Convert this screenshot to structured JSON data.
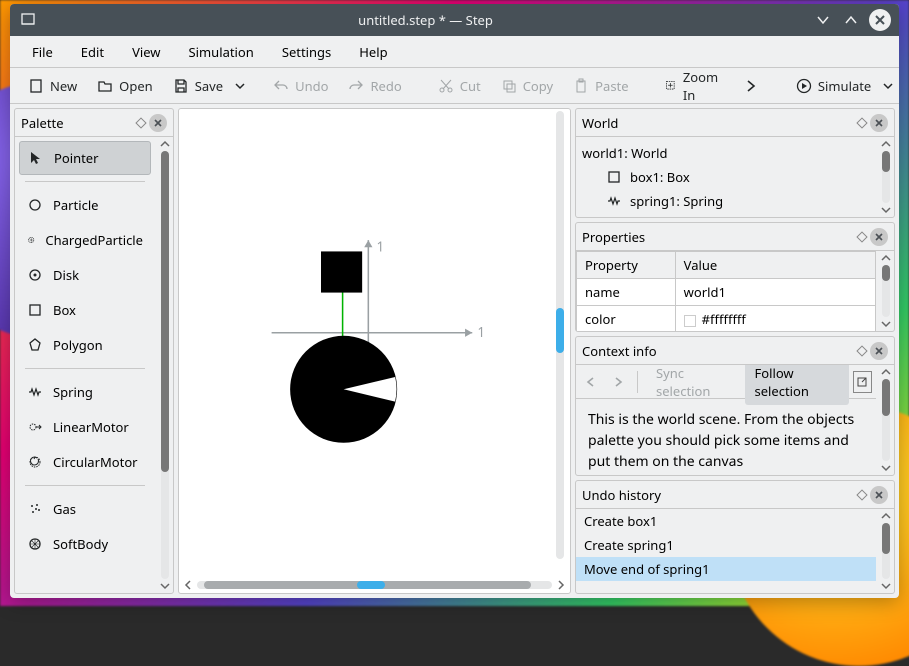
{
  "titlebar": {
    "title": "untitled.step * — Step"
  },
  "menu": [
    "File",
    "Edit",
    "View",
    "Simulation",
    "Settings",
    "Help"
  ],
  "toolbar": {
    "new": "New",
    "open": "Open",
    "save": "Save",
    "undo": "Undo",
    "redo": "Redo",
    "cut": "Cut",
    "copy": "Copy",
    "paste": "Paste",
    "zoom_in": "Zoom In",
    "simulate": "Simulate"
  },
  "palette": {
    "title": "Palette",
    "groups": [
      {
        "items": [
          {
            "name": "pointer",
            "label": "Pointer",
            "selected": true
          }
        ]
      },
      {
        "items": [
          {
            "name": "particle",
            "label": "Particle"
          },
          {
            "name": "charged-particle",
            "label": "ChargedParticle"
          },
          {
            "name": "disk",
            "label": "Disk"
          },
          {
            "name": "box",
            "label": "Box"
          },
          {
            "name": "polygon",
            "label": "Polygon"
          }
        ]
      },
      {
        "items": [
          {
            "name": "spring",
            "label": "Spring"
          },
          {
            "name": "linear-motor",
            "label": "LinearMotor"
          },
          {
            "name": "circular-motor",
            "label": "CircularMotor"
          }
        ]
      },
      {
        "items": [
          {
            "name": "gas",
            "label": "Gas"
          },
          {
            "name": "softbody",
            "label": "SoftBody"
          }
        ]
      }
    ]
  },
  "canvas": {
    "axis_x_label": "1",
    "axis_y_label": "1"
  },
  "world": {
    "title": "World",
    "root": "world1: World",
    "children": [
      {
        "icon": "box",
        "label": "box1: Box"
      },
      {
        "icon": "spring",
        "label": "spring1: Spring"
      }
    ]
  },
  "properties": {
    "title": "Properties",
    "col_property": "Property",
    "col_value": "Value",
    "rows": [
      {
        "prop": "name",
        "value": "world1"
      },
      {
        "prop": "color",
        "value": "#ffffffff"
      }
    ]
  },
  "context": {
    "title": "Context info",
    "sync": "Sync selection",
    "follow": "Follow selection",
    "text": "This is the world scene. From the objects palette you should pick some items and put them on the canvas"
  },
  "undo": {
    "title": "Undo history",
    "items": [
      {
        "label": "Create box1",
        "selected": false
      },
      {
        "label": "Create spring1",
        "selected": false
      },
      {
        "label": "Move end of spring1",
        "selected": true
      }
    ]
  }
}
